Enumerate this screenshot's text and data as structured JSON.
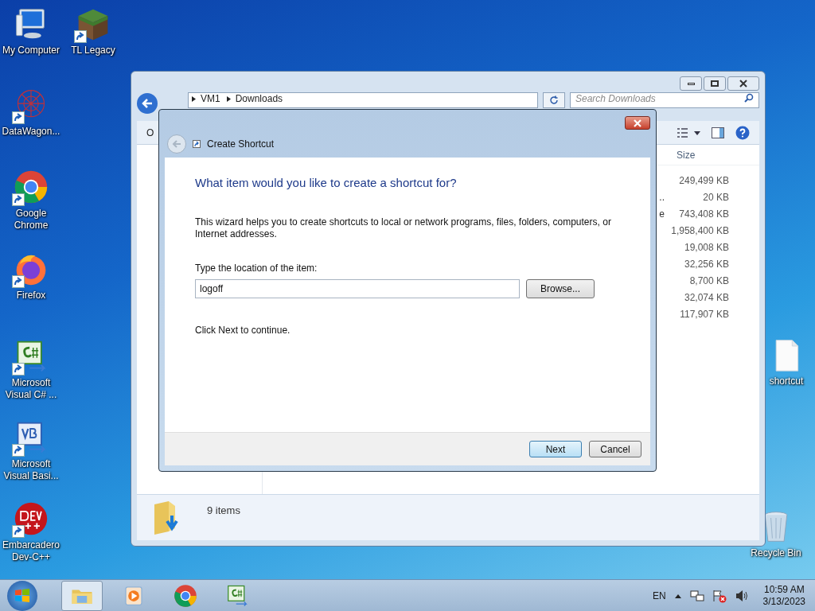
{
  "desktop_icons": [
    {
      "label": "My Computer",
      "kind": "computer",
      "shortcut": false
    },
    {
      "label": "TL Legacy",
      "kind": "block",
      "shortcut": true
    },
    {
      "label": "DataWagon...",
      "kind": "web",
      "shortcut": true
    },
    {
      "label": "Google Chrome",
      "kind": "chrome",
      "shortcut": true
    },
    {
      "label": "Firefox",
      "kind": "firefox",
      "shortcut": true
    },
    {
      "label": "Microsoft Visual C# ...",
      "kind": "csharp",
      "shortcut": true
    },
    {
      "label": "Microsoft Visual Basi...",
      "kind": "vb",
      "shortcut": true
    },
    {
      "label": "Embarcadero Dev-C++",
      "kind": "dev",
      "shortcut": true
    },
    {
      "label": "shortcut",
      "kind": "file",
      "shortcut": false
    },
    {
      "label": "Recycle Bin",
      "kind": "bin",
      "shortcut": false
    }
  ],
  "explorer": {
    "breadcrumb": [
      "VM1",
      "Downloads"
    ],
    "search": {
      "placeholder": "Search Downloads"
    },
    "toolbar_label": "O",
    "size_column": "Size",
    "rows": [
      {
        "size": "249,499 KB"
      },
      {
        "name_tail": "..",
        "size": "20 KB"
      },
      {
        "name_tail": "e",
        "size": "743,408 KB"
      },
      {
        "size": "1,958,400 KB"
      },
      {
        "size": "19,008 KB"
      },
      {
        "size": "32,256 KB"
      },
      {
        "size": "8,700 KB"
      },
      {
        "size": "32,074 KB"
      },
      {
        "size": "117,907 KB"
      }
    ],
    "status": "9 items"
  },
  "dialog": {
    "title": "Create Shortcut",
    "heading": "What item would you like to create a shortcut for?",
    "description": "This wizard helps you to create shortcuts to local or network programs, files, folders, computers, or Internet addresses.",
    "field_label": "Type the location of the item:",
    "field_value": "logoff",
    "browse": "Browse...",
    "hint": "Click Next to continue.",
    "buttons": [
      {
        "label": "Next",
        "default": true
      },
      {
        "label": "Cancel",
        "default": false
      }
    ]
  },
  "taskbar": {
    "apps": [
      {
        "kind": "explorer",
        "active": true
      },
      {
        "kind": "media",
        "active": false
      },
      {
        "kind": "chrome",
        "active": false
      },
      {
        "kind": "csharp",
        "active": false
      }
    ],
    "language": "EN",
    "time": "10:59 AM",
    "date": "3/13/2023"
  }
}
